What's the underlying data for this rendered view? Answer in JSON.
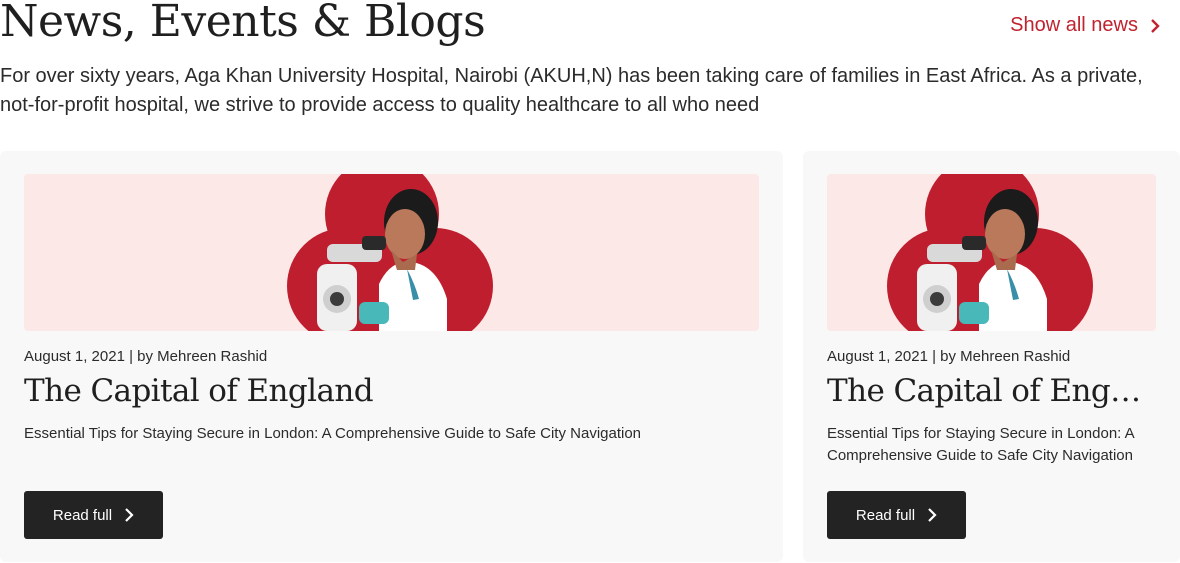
{
  "header": {
    "title": "News, Events & Blogs",
    "show_all_label": "Show all news",
    "intro": "For over sixty years, Aga Khan University Hospital, Nairobi (AKUH,N) has been taking care of families in East Africa. As a private, not-for-profit hospital, we strive to provide access to quality healthcare to all who need"
  },
  "colors": {
    "accent": "#c0232f",
    "card_bg": "#f8f8f8",
    "image_bg": "#fde8e8",
    "button_bg": "#232323"
  },
  "cards": [
    {
      "image_icon": "scientist-microscope-image",
      "meta": "August 1, 2021 | by Mehreen Rashid",
      "title": "The Capital of England",
      "excerpt": "Essential Tips for Staying Secure in London: A Comprehensive Guide to Safe City Navigation",
      "button_label": "Read full"
    },
    {
      "image_icon": "scientist-microscope-image",
      "meta": "August 1, 2021 | by Mehreen Rashid",
      "title": "The Capital of England",
      "excerpt": "Essential Tips for Staying Secure in London: A Comprehensive Guide to Safe City Navigation",
      "button_label": "Read full"
    }
  ]
}
